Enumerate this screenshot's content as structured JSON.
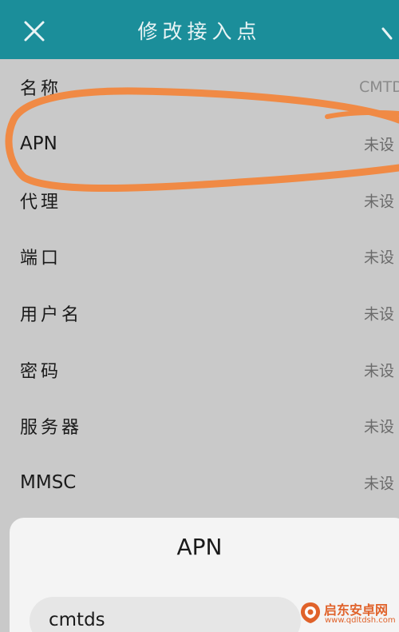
{
  "header": {
    "title": "修改接入点",
    "close_icon": "close-icon",
    "save_icon": "check-icon"
  },
  "apn_fields": [
    {
      "label": "名称",
      "value": "CMTD"
    },
    {
      "label": "APN",
      "value": "未设"
    },
    {
      "label": "代理",
      "value": "未设"
    },
    {
      "label": "端口",
      "value": "未设"
    },
    {
      "label": "用户名",
      "value": "未设"
    },
    {
      "label": "密码",
      "value": "未设"
    },
    {
      "label": "服务器",
      "value": "未设"
    },
    {
      "label": "MMSC",
      "value": "未设"
    }
  ],
  "dialog": {
    "title": "APN",
    "input_value": "cmtds"
  },
  "watermark": {
    "name": "启东安卓网",
    "url": "www.qdltdsh.com"
  },
  "colors": {
    "header_bg": "#1b8e9a",
    "screen_bg": "#c9c9c9",
    "annotation_stroke": "#f08a45",
    "dialog_bg": "#f4f4f4",
    "watermark": "#e0622a"
  }
}
